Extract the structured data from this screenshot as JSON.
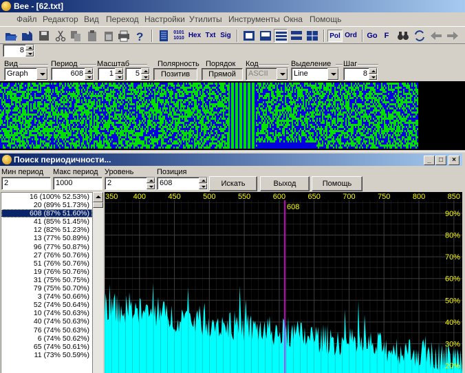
{
  "window": {
    "title": "Bee - [62.txt]"
  },
  "menu": [
    "Файл",
    "Редактор",
    "Вид",
    "Переход",
    "Настройки",
    "Утилиты",
    "Инструменты",
    "Окна",
    "Помощь"
  ],
  "toolbar": {
    "text_buttons": [
      "0101 1010",
      "Hex",
      "Txt",
      "Sig"
    ],
    "mode_buttons": [
      "Pol",
      "Ord"
    ],
    "nav_buttons": [
      "Go",
      "F"
    ]
  },
  "spinner_top": {
    "value": "8"
  },
  "controls": {
    "view": {
      "label": "Вид",
      "value": "Graph"
    },
    "period": {
      "label": "Период",
      "value": "608"
    },
    "scale": {
      "label": "Масштаб",
      "value1": "1",
      "value2": "5"
    },
    "polarity": {
      "label": "Полярность",
      "button": "Позитив"
    },
    "order": {
      "label": "Порядок",
      "button": "Прямой"
    },
    "code": {
      "label": "Код",
      "value": "ASCII"
    },
    "selection": {
      "label": "Выделение",
      "value": "Line"
    },
    "step": {
      "label": "Шаг",
      "value": "8"
    }
  },
  "colors": {
    "bit_one": "#00e000",
    "bit_zero": "#0000e0",
    "spectrum": "#00ffff",
    "marker": "#ff00ff",
    "grid": "#555555",
    "axis_text": "#ffff00"
  },
  "dialog": {
    "title": "Поиск периодичности...",
    "controls": [
      "_",
      "□",
      "×"
    ],
    "min_period": {
      "label": "Мин период",
      "value": "2"
    },
    "max_period": {
      "label": "Макс период",
      "value": "1000"
    },
    "level": {
      "label": "Уровень",
      "value": "2"
    },
    "position": {
      "label": "Позиция",
      "value": "608"
    },
    "buttons": {
      "search": "Искать",
      "exit": "Выход",
      "help": "Помощь"
    },
    "results": [
      "16 (100% 52.53%)",
      "20 (89% 51.73%)",
      "608 (87% 51.60%)",
      "41 (85% 51.45%)",
      "12 (82% 51.23%)",
      "13 (77% 50.89%)",
      "96 (77% 50.87%)",
      "27 (76% 50.76%)",
      "51 (76% 50.76%)",
      "19 (76% 50.76%)",
      "31 (75% 50.75%)",
      "79 (75% 50.70%)",
      "3 (74% 50.66%)",
      "52 (74% 50.64%)",
      "10 (74% 50.63%)",
      "40 (74% 50.63%)",
      "76 (74% 50.63%)",
      "6 (74% 50.62%)",
      "65 (74% 50.61%)",
      "11 (73% 50.59%)"
    ],
    "selected_index": 2
  },
  "chart_data": {
    "type": "area",
    "x_ticks": [
      "350",
      "400",
      "450",
      "500",
      "550",
      "600",
      "650",
      "700",
      "750",
      "800",
      "850"
    ],
    "y_ticks": [
      "90%",
      "80%",
      "70%",
      "60%",
      "50%",
      "40%",
      "30%",
      "20%"
    ],
    "xlim": [
      350,
      862
    ],
    "ylim": [
      0,
      100
    ],
    "marker": {
      "x": 608,
      "label": "608"
    },
    "grid": true
  }
}
